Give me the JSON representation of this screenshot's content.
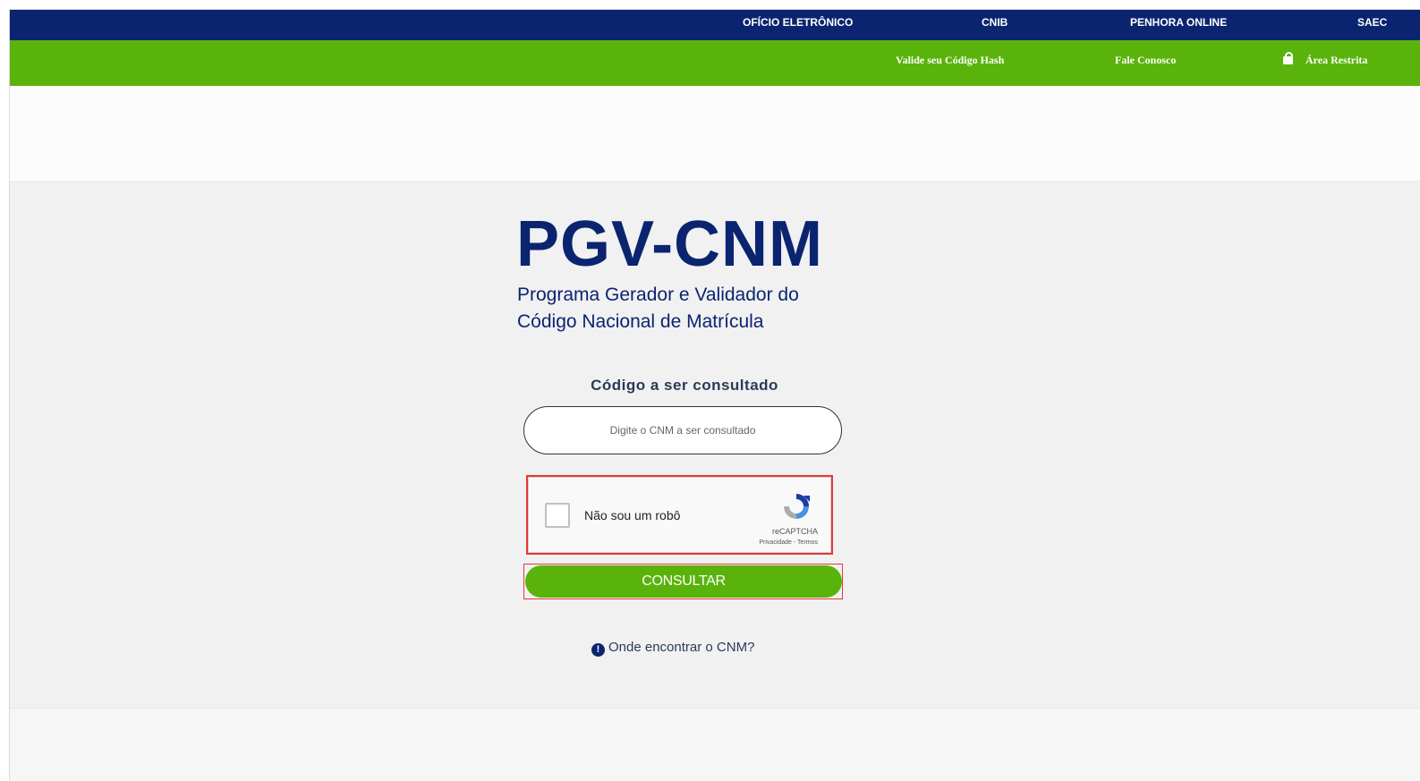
{
  "top_nav": {
    "items": [
      "OFÍCIO ELETRÔNICO",
      "CNIB",
      "PENHORA ONLINE",
      "SAEC"
    ]
  },
  "secondary_nav": {
    "items": [
      "Valide seu Código Hash",
      "Fale Conosco",
      "Área Restrita"
    ]
  },
  "logo": {
    "title": "PGV-CNM",
    "subtitle_line1": "Programa Gerador e Validador do",
    "subtitle_line2": "Código Nacional de Matrícula"
  },
  "form": {
    "label": "Código a ser consultado",
    "input_placeholder": "Digite o CNM a ser consultado",
    "input_value": "",
    "captcha_label": "Não sou um robô",
    "captcha_brand": "reCAPTCHA",
    "captcha_links": "Privacidade - Termos",
    "submit_label": "CONSULTAR",
    "help_link": "Onde encontrar o CNM?"
  },
  "colors": {
    "navy": "#0b2470",
    "green": "#5ab30b",
    "highlight": "#e53935"
  }
}
